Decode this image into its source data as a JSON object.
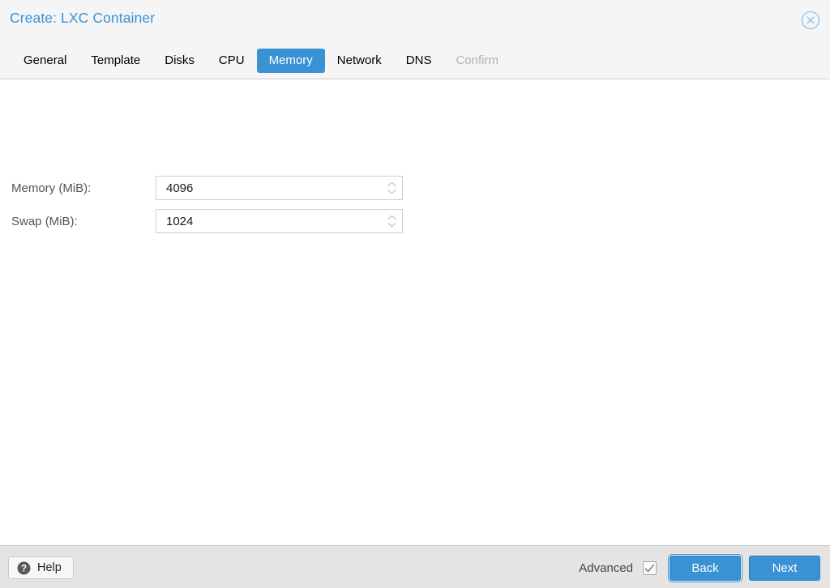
{
  "window": {
    "title": "Create: LXC Container",
    "close_icon": "close-circle-icon",
    "accent_color": "#3892d4",
    "header_bg": "#f5f5f5",
    "body_bg": "#ffffff",
    "footer_bg": "#e4e4e4"
  },
  "tabs": [
    {
      "label": "General",
      "state": "inactive"
    },
    {
      "label": "Template",
      "state": "inactive"
    },
    {
      "label": "Disks",
      "state": "inactive"
    },
    {
      "label": "CPU",
      "state": "inactive"
    },
    {
      "label": "Memory",
      "state": "active"
    },
    {
      "label": "Network",
      "state": "inactive"
    },
    {
      "label": "DNS",
      "state": "inactive"
    },
    {
      "label": "Confirm",
      "state": "disabled"
    }
  ],
  "form": {
    "fields": [
      {
        "label": "Memory (MiB):",
        "value": "4096",
        "placeholder": "",
        "control": "number-spinner"
      },
      {
        "label": "Swap (MiB):",
        "value": "1024",
        "placeholder": "",
        "control": "number-spinner"
      }
    ]
  },
  "footer": {
    "help_label": "Help",
    "help_icon": "question-mark-circle-icon",
    "advanced_label": "Advanced",
    "advanced_checked": true,
    "check_icon": "checkmark-icon",
    "back_label": "Back",
    "next_label": "Next",
    "back_focused": true
  }
}
